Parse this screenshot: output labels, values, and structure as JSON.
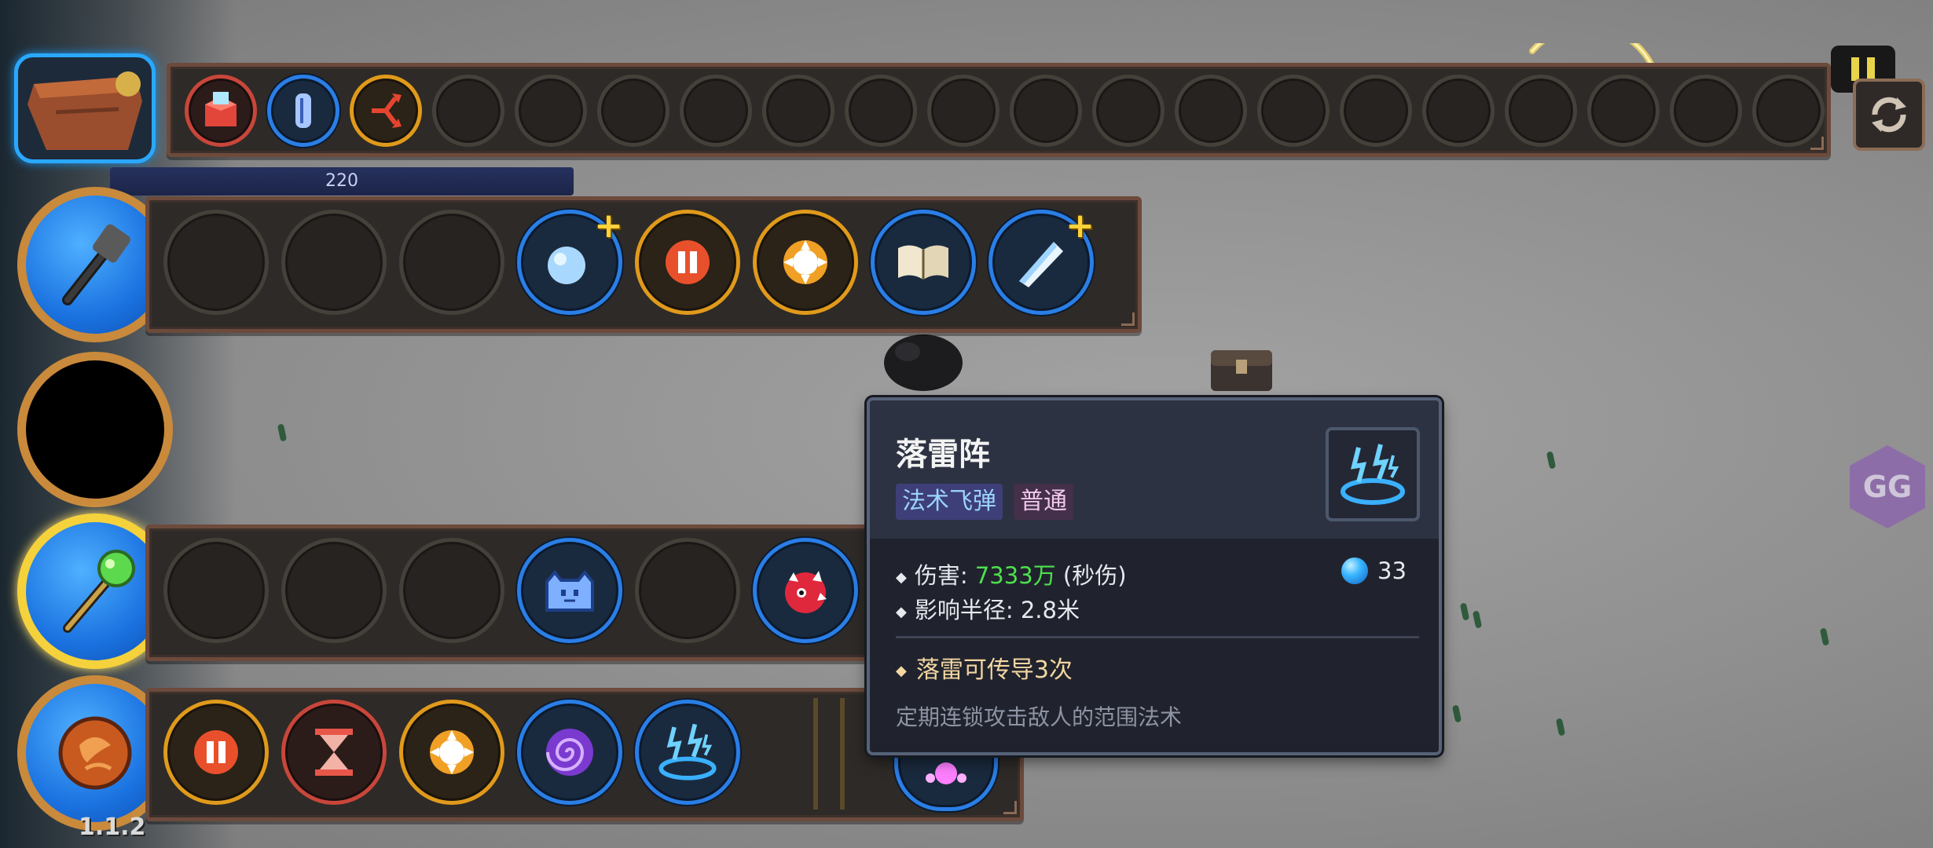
{
  "hud": {
    "mana_value": "220",
    "version": "1.1.2"
  },
  "inventory_bar": {
    "slots": [
      {
        "icon": "red-box-item-icon",
        "ring": "red"
      },
      {
        "icon": "blue-capsule-item-icon",
        "ring": "blue"
      },
      {
        "icon": "split-arrows-item-icon",
        "ring": "gold"
      },
      {
        "icon": "empty"
      },
      {
        "icon": "empty"
      },
      {
        "icon": "empty"
      },
      {
        "icon": "empty"
      },
      {
        "icon": "empty"
      },
      {
        "icon": "empty"
      },
      {
        "icon": "empty"
      },
      {
        "icon": "empty"
      },
      {
        "icon": "empty"
      },
      {
        "icon": "empty"
      },
      {
        "icon": "empty"
      },
      {
        "icon": "empty"
      },
      {
        "icon": "empty"
      },
      {
        "icon": "empty"
      },
      {
        "icon": "empty"
      },
      {
        "icon": "empty"
      },
      {
        "icon": "empty"
      }
    ]
  },
  "wand_rows": [
    {
      "wand_icon": "hammer-staff-icon",
      "slots": [
        "empty",
        "empty",
        "empty",
        "ice-orb-plus-icon",
        "pause-modifier-icon",
        "target-modifier-icon",
        "spellbook-icon",
        "ice-shard-plus-icon"
      ]
    },
    {
      "wand_icon": "empty-wand-slot",
      "slots": []
    },
    {
      "wand_icon": "green-orb-staff-icon",
      "slots": [
        "empty",
        "empty",
        "empty",
        "blue-slime-icon",
        "empty",
        "red-spiked-icon"
      ]
    },
    {
      "wand_icon": "fire-orb-icon",
      "slots": [
        "pause-modifier-icon",
        "hourglass-modifier-icon",
        "target-modifier-icon",
        "purple-vortex-icon",
        "lightning-circle-icon"
      ]
    }
  ],
  "tooltip": {
    "title": "落雷阵",
    "tags": [
      "法术飞弹",
      "普通"
    ],
    "icon": "lightning-circle-icon",
    "stats": {
      "damage_label": "伤害: ",
      "damage_value": "7333万",
      "damage_suffix": " (秒伤)",
      "radius_label": "影响半径: 2.8米"
    },
    "mana_cost": "33",
    "trait": "落雷可传导3次",
    "description": "定期连锁攻击敌人的范围法术"
  },
  "colors": {
    "slot_blue": "#2a7ee6",
    "slot_gold": "#e09a1b",
    "slot_red": "#c8463a",
    "damage_green": "#4ee04e",
    "tag_spell_bg": "#3e3f78",
    "tag_normal_bg": "#44304a"
  }
}
